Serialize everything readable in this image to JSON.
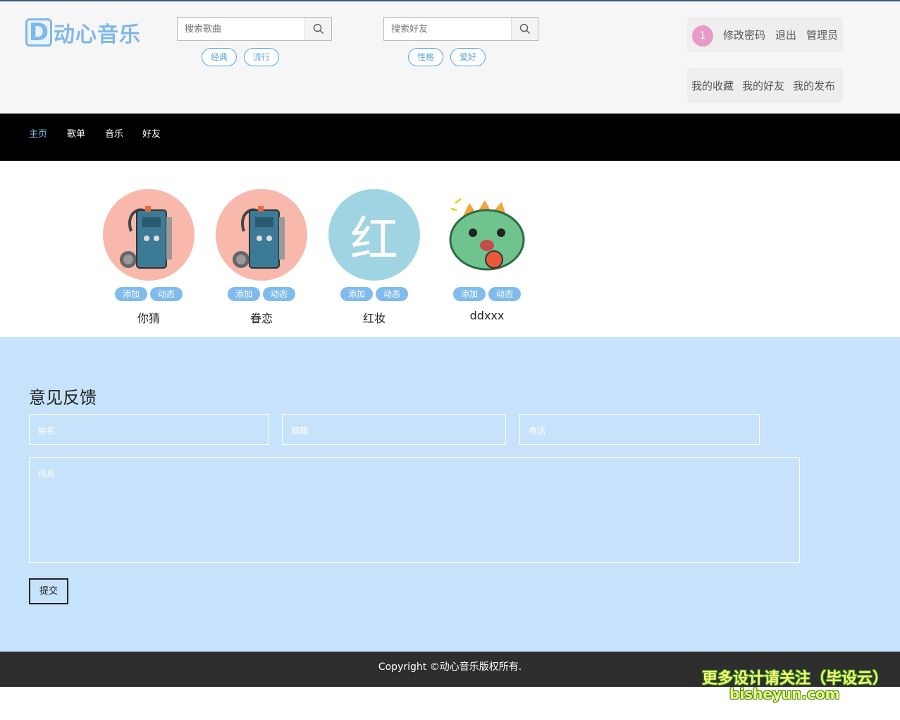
{
  "logo": {
    "letter": "D",
    "text": "动心音乐"
  },
  "song_search": {
    "placeholder": "搜索歌曲",
    "tags": [
      "经典",
      "流行"
    ]
  },
  "friend_search": {
    "placeholder": "搜索好友",
    "tags": [
      "性格",
      "爱好"
    ]
  },
  "user": {
    "badge": "1",
    "links": [
      "修改密码",
      "退出",
      "管理员"
    ],
    "links2": [
      "我的收藏",
      "我的好友",
      "我的发布"
    ]
  },
  "nav": {
    "items": [
      "主页",
      "歌单",
      "音乐",
      "好友"
    ],
    "active": "主页"
  },
  "friends": [
    {
      "name": "你猜",
      "avatar": "cassette-player",
      "add": "添加",
      "feed": "动态"
    },
    {
      "name": "眷恋",
      "avatar": "cassette-player",
      "add": "添加",
      "feed": "动态"
    },
    {
      "name": "红妆",
      "avatar_char": "红",
      "add": "添加",
      "feed": "动态"
    },
    {
      "name": "ddxxx",
      "avatar": "green-dragon",
      "add": "添加",
      "feed": "动态"
    }
  ],
  "feedback": {
    "title": "意见反馈",
    "name_placeholder": "姓名",
    "email_placeholder": "邮箱",
    "phone_placeholder": "电话",
    "message_placeholder": "信息",
    "submit": "提交"
  },
  "footer": {
    "copyright": "Copyright ©动心音乐版权所有."
  },
  "watermark": {
    "line1": "更多设计请关注（毕设云）",
    "line2": "bisheyun.com"
  },
  "colors": {
    "accent": "#7fb8ea",
    "nav_bg": "#000000",
    "feedback_bg": "#c7e3fb",
    "footer_bg": "#2e2e2e"
  }
}
